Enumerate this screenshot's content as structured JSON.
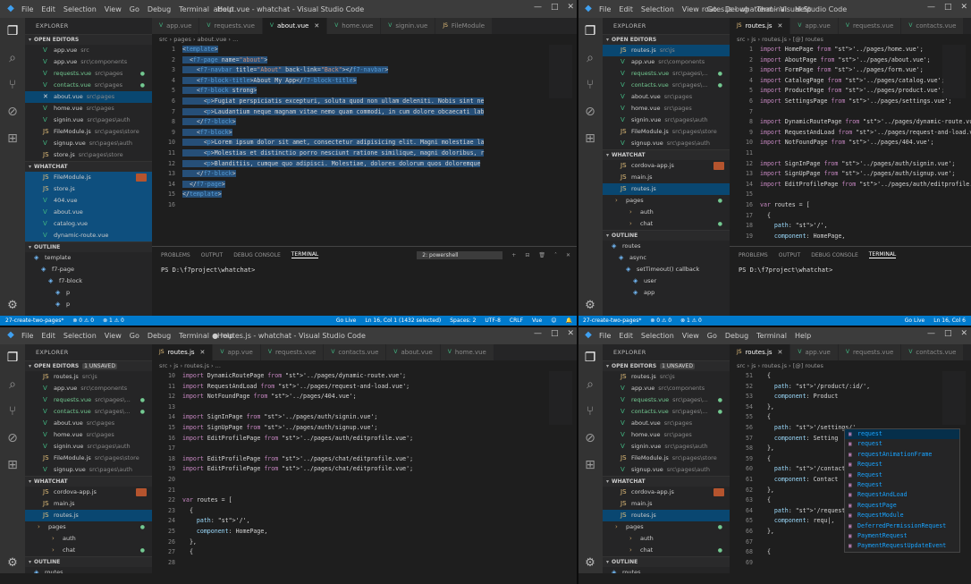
{
  "windows": [
    {
      "id": "tl",
      "title": "about.vue - whatchat - Visual Studio Code",
      "menu": [
        "File",
        "Edit",
        "Selection",
        "View",
        "Go",
        "Debug",
        "Terminal",
        "Help"
      ],
      "explorer_title": "EXPLORER",
      "open_editors": {
        "title": "OPEN EDITORS",
        "unsaved": ""
      },
      "open_files": [
        {
          "name": "app.vue",
          "dir": "src",
          "icon": "vue",
          "mod": false,
          "sel": false
        },
        {
          "name": "app.vue",
          "dir": "src\\components",
          "icon": "vue",
          "mod": false,
          "sel": false
        },
        {
          "name": "requests.vue",
          "dir": "src\\pages",
          "icon": "vue",
          "mod": true,
          "sel": false
        },
        {
          "name": "contacts.vue",
          "dir": "src\\pages",
          "icon": "vue",
          "mod": true,
          "sel": false
        },
        {
          "name": "about.vue",
          "dir": "src\\pages",
          "icon": "x",
          "mod": false,
          "sel": true
        },
        {
          "name": "home.vue",
          "dir": "src\\pages",
          "icon": "vue",
          "mod": false,
          "sel": false
        },
        {
          "name": "signin.vue",
          "dir": "src\\pages\\auth",
          "icon": "vue",
          "mod": false,
          "sel": false
        },
        {
          "name": "FileModule.js",
          "dir": "src\\pages\\store",
          "icon": "js",
          "mod": false,
          "sel": false
        },
        {
          "name": "signup.vue",
          "dir": "src\\pages\\auth",
          "icon": "vue",
          "mod": false,
          "sel": false
        },
        {
          "name": "store.js",
          "dir": "src\\pages\\store",
          "icon": "js",
          "mod": false,
          "sel": false
        }
      ],
      "project": {
        "title": "WHATCHAT"
      },
      "tree": [
        {
          "name": "FileModule.js",
          "icon": "js",
          "blue": true,
          "gulp": true
        },
        {
          "name": "store.js",
          "icon": "js",
          "blue": true
        },
        {
          "name": "404.vue",
          "icon": "vue",
          "blue": true
        },
        {
          "name": "about.vue",
          "icon": "vue",
          "blue": true
        },
        {
          "name": "catalog.vue",
          "icon": "vue",
          "blue": true
        },
        {
          "name": "dynamic-route.vue",
          "icon": "vue",
          "blue": true
        }
      ],
      "outline": {
        "title": "OUTLINE",
        "items": [
          "template",
          "f7-page",
          "f7-block",
          "p",
          "p"
        ]
      },
      "tabs": [
        {
          "label": "app.vue",
          "t": "v"
        },
        {
          "label": "requests.vue",
          "t": "v"
        },
        {
          "label": "about.vue",
          "t": "v",
          "act": true
        },
        {
          "label": "home.vue",
          "t": "v"
        },
        {
          "label": "signin.vue",
          "t": "v"
        },
        {
          "label": "FileModule",
          "t": "j"
        }
      ],
      "breadcrumb": "src › pages › about.vue › ...",
      "lines": [
        "1",
        "2",
        "3",
        "4",
        "5",
        "6",
        "7",
        "8",
        "9",
        "10",
        "11",
        "12",
        "13",
        "14",
        "15",
        "16"
      ],
      "code": [
        "<template>",
        "  <f7-page name=\"about\">",
        "    <f7-navbar title=\"About\" back-link=\"Back\"></f7-navbar>",
        "    <f7-block-title>About My App</f7-block-title>",
        "    <f7-block strong>",
        "      <p>Fugiat perspiciatis excepturi, soluta quod non ullam deleniti. Nobis sint ne",
        "      <p>Laudantium neque magnam vitae nemo quam commodi, in cum dolore obcaecati lab",
        "    </f7-block>",
        "    <f7-block>",
        "      <p>Lorem ipsum dolor sit amet, consectetur adipisicing elit. Magni molestiae la",
        "      <p>Molestias et distinctio porro nesciunt ratione similique, magni doloribus, r",
        "      <p>Blanditiis, cumque quo adipisci. Molestiae, dolores dolorum quos doloremque",
        "    </f7-block>",
        "  </f7-page>",
        "</template>",
        ""
      ],
      "panel": {
        "tabs": [
          "PROBLEMS",
          "OUTPUT",
          "DEBUG CONSOLE",
          "TERMINAL"
        ],
        "terminal_select": "2: powershell",
        "prompt": "PS D:\\f7project\\whatchat> "
      },
      "status": {
        "left": [
          "27-create-two-pages*",
          "⊗ 0 ⚠ 0",
          "⊗ 1 ⚠ 0"
        ],
        "right": [
          "Go Live",
          "Ln 16, Col 1 (1432 selected)",
          "Spaces: 2",
          "UTF-8",
          "CRLF",
          "Vue",
          "☺",
          "🔔"
        ]
      }
    },
    {
      "id": "tr",
      "title": "routes.js - whatchat - Visual Studio Code",
      "menu": [
        "File",
        "Edit",
        "Selection",
        "View",
        "Go",
        "Debug",
        "Terminal",
        "Help"
      ],
      "explorer_title": "EXPLORER",
      "open_editors": {
        "title": "OPEN EDITORS",
        "unsaved": ""
      },
      "open_files": [
        {
          "name": "routes.js",
          "dir": "src\\js",
          "icon": "js",
          "mod": false,
          "sel": true
        },
        {
          "name": "app.vue",
          "dir": "src\\components",
          "icon": "vue",
          "mod": false,
          "sel": false
        },
        {
          "name": "requests.vue",
          "dir": "src\\pages\\...",
          "icon": "vue",
          "mod": true,
          "sel": false
        },
        {
          "name": "contacts.vue",
          "dir": "src\\pages\\...",
          "icon": "vue",
          "mod": true,
          "sel": false
        },
        {
          "name": "about.vue",
          "dir": "src\\pages",
          "icon": "vue",
          "mod": false,
          "sel": false
        },
        {
          "name": "home.vue",
          "dir": "src\\pages",
          "icon": "vue",
          "mod": false,
          "sel": false
        },
        {
          "name": "signin.vue",
          "dir": "src\\pages\\auth",
          "icon": "vue",
          "mod": false,
          "sel": false
        },
        {
          "name": "FileModule.js",
          "dir": "src\\pages\\store",
          "icon": "js",
          "mod": false,
          "sel": false
        },
        {
          "name": "signup.vue",
          "dir": "src\\pages\\auth",
          "icon": "vue",
          "mod": false,
          "sel": false
        }
      ],
      "project": {
        "title": "WHATCHAT"
      },
      "tree": [
        {
          "name": "cordova-app.js",
          "icon": "js",
          "gulp": true
        },
        {
          "name": "main.js",
          "icon": "js"
        },
        {
          "name": "routes.js",
          "icon": "js",
          "sel": true
        },
        {
          "name": "pages",
          "icon": "fold",
          "folder": true,
          "badge": "●"
        },
        {
          "name": "auth",
          "icon": "fold",
          "folder": true,
          "sub": true
        },
        {
          "name": "chat",
          "icon": "fold",
          "folder": true,
          "sub": true,
          "badge": "●"
        }
      ],
      "outline": {
        "title": "OUTLINE",
        "items": [
          "routes",
          "async",
          "setTimeout() callback",
          "user",
          "app"
        ]
      },
      "tabs": [
        {
          "label": "routes.js",
          "t": "j",
          "act": true
        },
        {
          "label": "app.vue",
          "t": "v"
        },
        {
          "label": "requests.vue",
          "t": "v"
        },
        {
          "label": "contacts.vue",
          "t": "v"
        }
      ],
      "breadcrumb": "src › js › routes.js › [@] routes",
      "lines": [
        "1",
        "2",
        "3",
        "4",
        "5",
        "6",
        "7",
        "8",
        "9",
        "10",
        "11",
        "12",
        "13",
        "14",
        "15",
        "16",
        "17",
        "18",
        "19"
      ],
      "code": [
        "import HomePage from '../pages/home.vue';",
        "import AboutPage from '../pages/about.vue';",
        "import FormPage from '../pages/form.vue';",
        "import CatalogPage from '../pages/catalog.vue';",
        "import ProductPage from '../pages/product.vue';",
        "import SettingsPage from '../pages/settings.vue';",
        "",
        "import DynamicRoutePage from '../pages/dynamic-route.vue';",
        "import RequestAndLoad from '../pages/request-and-load.vue';",
        "import NotFoundPage from '../pages/404.vue';",
        "",
        "import SignInPage from '../pages/auth/signin.vue';",
        "import SignUpPage from '../pages/auth/signup.vue';",
        "import EditProfilePage from '../pages/auth/editprofile.vue';",
        "",
        "var routes = [",
        "  {",
        "    path: '/',",
        "    component: HomePage,"
      ],
      "panel": {
        "tabs": [
          "PROBLEMS",
          "OUTPUT",
          "DEBUG CONSOLE",
          "TERMINAL"
        ],
        "terminal_select": "",
        "prompt": "PS D:\\f7project\\whatchat> "
      },
      "status": {
        "left": [
          "27-create-two-pages*",
          "⊗ 0 ⚠ 0",
          "⊗ 1 ⚠ 0"
        ],
        "right": [
          "Go Live",
          "Ln 16, Col 6"
        ]
      }
    },
    {
      "id": "bl",
      "title": "● routes.js - whatchat - Visual Studio Code",
      "menu": [
        "File",
        "Edit",
        "Selection",
        "View",
        "Go",
        "Debug",
        "Terminal",
        "Help"
      ],
      "explorer_title": "EXPLORER",
      "open_editors": {
        "title": "OPEN EDITORS",
        "unsaved": "1 UNSAVED"
      },
      "open_files": [
        {
          "name": "routes.js",
          "dir": "src\\js",
          "icon": "js",
          "mod": false,
          "sel": false
        },
        {
          "name": "app.vue",
          "dir": "src\\components",
          "icon": "vue",
          "mod": false,
          "sel": false
        },
        {
          "name": "requests.vue",
          "dir": "src\\pages\\...",
          "icon": "vue",
          "mod": true,
          "sel": false
        },
        {
          "name": "contacts.vue",
          "dir": "src\\pages\\...",
          "icon": "vue",
          "mod": true,
          "sel": false
        },
        {
          "name": "about.vue",
          "dir": "src\\pages",
          "icon": "vue",
          "mod": false,
          "sel": false
        },
        {
          "name": "home.vue",
          "dir": "src\\pages",
          "icon": "vue",
          "mod": false,
          "sel": false
        },
        {
          "name": "signin.vue",
          "dir": "src\\pages\\auth",
          "icon": "vue",
          "mod": false,
          "sel": false
        },
        {
          "name": "FileModule.js",
          "dir": "src\\pages\\store",
          "icon": "js",
          "mod": false,
          "sel": false
        },
        {
          "name": "signup.vue",
          "dir": "src\\pages\\auth",
          "icon": "vue",
          "mod": false,
          "sel": false
        }
      ],
      "project": {
        "title": "WHATCHAT"
      },
      "tree": [
        {
          "name": "cordova-app.js",
          "icon": "js",
          "gulp": true
        },
        {
          "name": "main.js",
          "icon": "js"
        },
        {
          "name": "routes.js",
          "icon": "js",
          "sel": true
        },
        {
          "name": "pages",
          "icon": "fold",
          "folder": true,
          "badge": "●"
        },
        {
          "name": "auth",
          "icon": "fold",
          "folder": true,
          "sub": true
        },
        {
          "name": "chat",
          "icon": "fold",
          "folder": true,
          "sub": true,
          "badge": "●"
        }
      ],
      "outline": {
        "title": "OUTLINE",
        "items": [
          "routes"
        ]
      },
      "tabs": [
        {
          "label": "routes.js",
          "t": "j",
          "act": true
        },
        {
          "label": "app.vue",
          "t": "v"
        },
        {
          "label": "requests.vue",
          "t": "v"
        },
        {
          "label": "contacts.vue",
          "t": "v"
        },
        {
          "label": "about.vue",
          "t": "v"
        },
        {
          "label": "home.vue",
          "t": "v"
        }
      ],
      "breadcrumb": "src › js › routes.js › ...",
      "lines": [
        "10",
        "11",
        "12",
        "13",
        "14",
        "15",
        "16",
        "17",
        "18",
        "19",
        "20",
        "21",
        "22",
        "23",
        "24",
        "25",
        "26",
        "27",
        "28"
      ],
      "code": [
        "import DynamicRoutePage from '../pages/dynamic-route.vue';",
        "import RequestAndLoad from '../pages/request-and-load.vue';",
        "import NotFoundPage from '../pages/404.vue';",
        "",
        "import SignInPage from '../pages/auth/signin.vue';",
        "import SignUpPage from '../pages/auth/signup.vue';",
        "import EditProfilePage from '../pages/auth/editprofile.vue';",
        "",
        "import EditProfilePage from '../pages/chat/editprofile.vue';",
        "import EditProfilePage from '../pages/chat/editprofile.vue';",
        "",
        "",
        "var routes = [",
        "  {",
        "    path: '/',",
        "    component: HomePage,",
        "  },",
        "  {",
        ""
      ]
    },
    {
      "id": "br",
      "title": "",
      "menu": [
        "File",
        "Edit",
        "Selection",
        "View",
        "Go",
        "Debug",
        "Terminal",
        "Help"
      ],
      "explorer_title": "EXPLORER",
      "open_editors": {
        "title": "OPEN EDITORS",
        "unsaved": "1 UNSAVED"
      },
      "open_files": [
        {
          "name": "routes.js",
          "dir": "src\\js",
          "icon": "js",
          "mod": false,
          "sel": false
        },
        {
          "name": "app.vue",
          "dir": "src\\components",
          "icon": "vue",
          "mod": false,
          "sel": false
        },
        {
          "name": "requests.vue",
          "dir": "src\\pages\\...",
          "icon": "vue",
          "mod": true,
          "sel": false
        },
        {
          "name": "contacts.vue",
          "dir": "src\\pages\\...",
          "icon": "vue",
          "mod": true,
          "sel": false
        },
        {
          "name": "about.vue",
          "dir": "src\\pages",
          "icon": "vue",
          "mod": false,
          "sel": false
        },
        {
          "name": "home.vue",
          "dir": "src\\pages",
          "icon": "vue",
          "mod": false,
          "sel": false
        },
        {
          "name": "signin.vue",
          "dir": "src\\pages\\auth",
          "icon": "vue",
          "mod": false,
          "sel": false
        },
        {
          "name": "FileModule.js",
          "dir": "src\\pages\\store",
          "icon": "js",
          "mod": false,
          "sel": false
        },
        {
          "name": "signup.vue",
          "dir": "src\\pages\\auth",
          "icon": "vue",
          "mod": false,
          "sel": false
        }
      ],
      "project": {
        "title": "WHATCHAT"
      },
      "tree": [
        {
          "name": "cordova-app.js",
          "icon": "js",
          "gulp": true
        },
        {
          "name": "main.js",
          "icon": "js"
        },
        {
          "name": "routes.js",
          "icon": "js",
          "sel": true
        },
        {
          "name": "pages",
          "icon": "fold",
          "folder": true,
          "badge": "●"
        },
        {
          "name": "auth",
          "icon": "fold",
          "folder": true,
          "sub": true
        },
        {
          "name": "chat",
          "icon": "fold",
          "folder": true,
          "sub": true,
          "badge": "●"
        }
      ],
      "outline": {
        "title": "OUTLINE",
        "items": [
          "routes"
        ]
      },
      "tabs": [
        {
          "label": "routes.js",
          "t": "j",
          "act": true
        },
        {
          "label": "app.vue",
          "t": "v"
        },
        {
          "label": "requests.vue",
          "t": "v"
        },
        {
          "label": "contacts.vue",
          "t": "v"
        }
      ],
      "breadcrumb": "src › js › routes.js › [@] routes",
      "lines": [
        "51",
        "52",
        "53",
        "54",
        "55",
        "56",
        "57",
        "58",
        "59",
        "60",
        "61",
        "62",
        "63",
        "64",
        "65",
        "66",
        "67",
        "68",
        "69"
      ],
      "code": [
        "  {",
        "    path: '/product/:id/',",
        "    component: Product",
        "  },",
        "  {",
        "    path: '/settings/',",
        "    component: Setting",
        "  },",
        "  {",
        "    path: '/contacts/',",
        "    component: Contact",
        "  },",
        "  {",
        "    path: '/requests/',",
        "    component: requ|,",
        "  },",
        "",
        "  {",
        ""
      ],
      "autocomplete": [
        "request",
        "request",
        "requestAnimationFrame",
        "Request",
        "Request",
        "Request",
        "RequestAndLoad",
        "RequestPage",
        "RequestModule",
        "DeferredPermissionRequest",
        "PaymentRequest",
        "PaymentRequestUpdateEvent"
      ]
    }
  ]
}
